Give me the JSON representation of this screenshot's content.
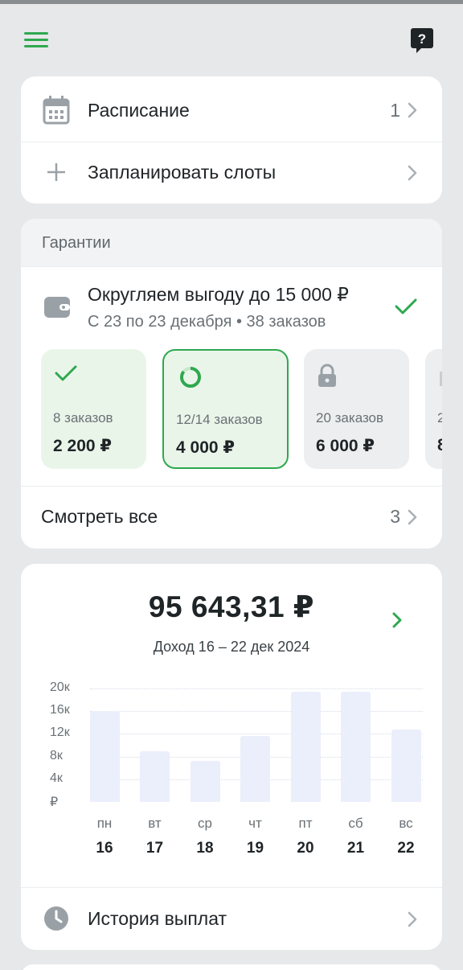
{
  "schedule": {
    "label": "Расписание",
    "count": "1"
  },
  "plan_slots": {
    "label": "Запланировать слоты"
  },
  "guarantees": {
    "header": "Гарантии",
    "offer_title": "Округляем выгоду до 15 000 ₽",
    "offer_subtitle": "С 23 по 23 декабря • 38 заказов",
    "tiers": [
      {
        "orders": "8 заказов",
        "amount": "2 200 ₽",
        "state": "done"
      },
      {
        "orders": "12/14 заказов",
        "amount": "4 000 ₽",
        "state": "in-progress"
      },
      {
        "orders": "20 заказов",
        "amount": "6 000 ₽",
        "state": "locked"
      },
      {
        "orders": "2",
        "amount": "8",
        "state": "locked"
      }
    ],
    "see_all_label": "Смотреть все",
    "see_all_count": "3"
  },
  "income": {
    "amount": "95 643,31 ₽",
    "period": "Доход 16 – 22 дек 2024"
  },
  "chart_data": {
    "type": "bar",
    "categories": [
      "16",
      "17",
      "18",
      "19",
      "20",
      "21",
      "22"
    ],
    "day_names": [
      "пн",
      "вт",
      "ср",
      "чт",
      "пт",
      "сб",
      "вс"
    ],
    "values": [
      16000,
      9000,
      7200,
      11600,
      19500,
      19400,
      12800
    ],
    "y_ticks": [
      "20к",
      "16к",
      "12к",
      "8к",
      "4к",
      "₽"
    ],
    "ylim": [
      0,
      20000
    ],
    "grid": true,
    "colors": {
      "bar": "#ebeffb"
    }
  },
  "payout_history": {
    "label": "История выплат"
  },
  "colors": {
    "accent": "#2fa84f",
    "background": "#e6e8e9",
    "card": "#ffffff"
  }
}
